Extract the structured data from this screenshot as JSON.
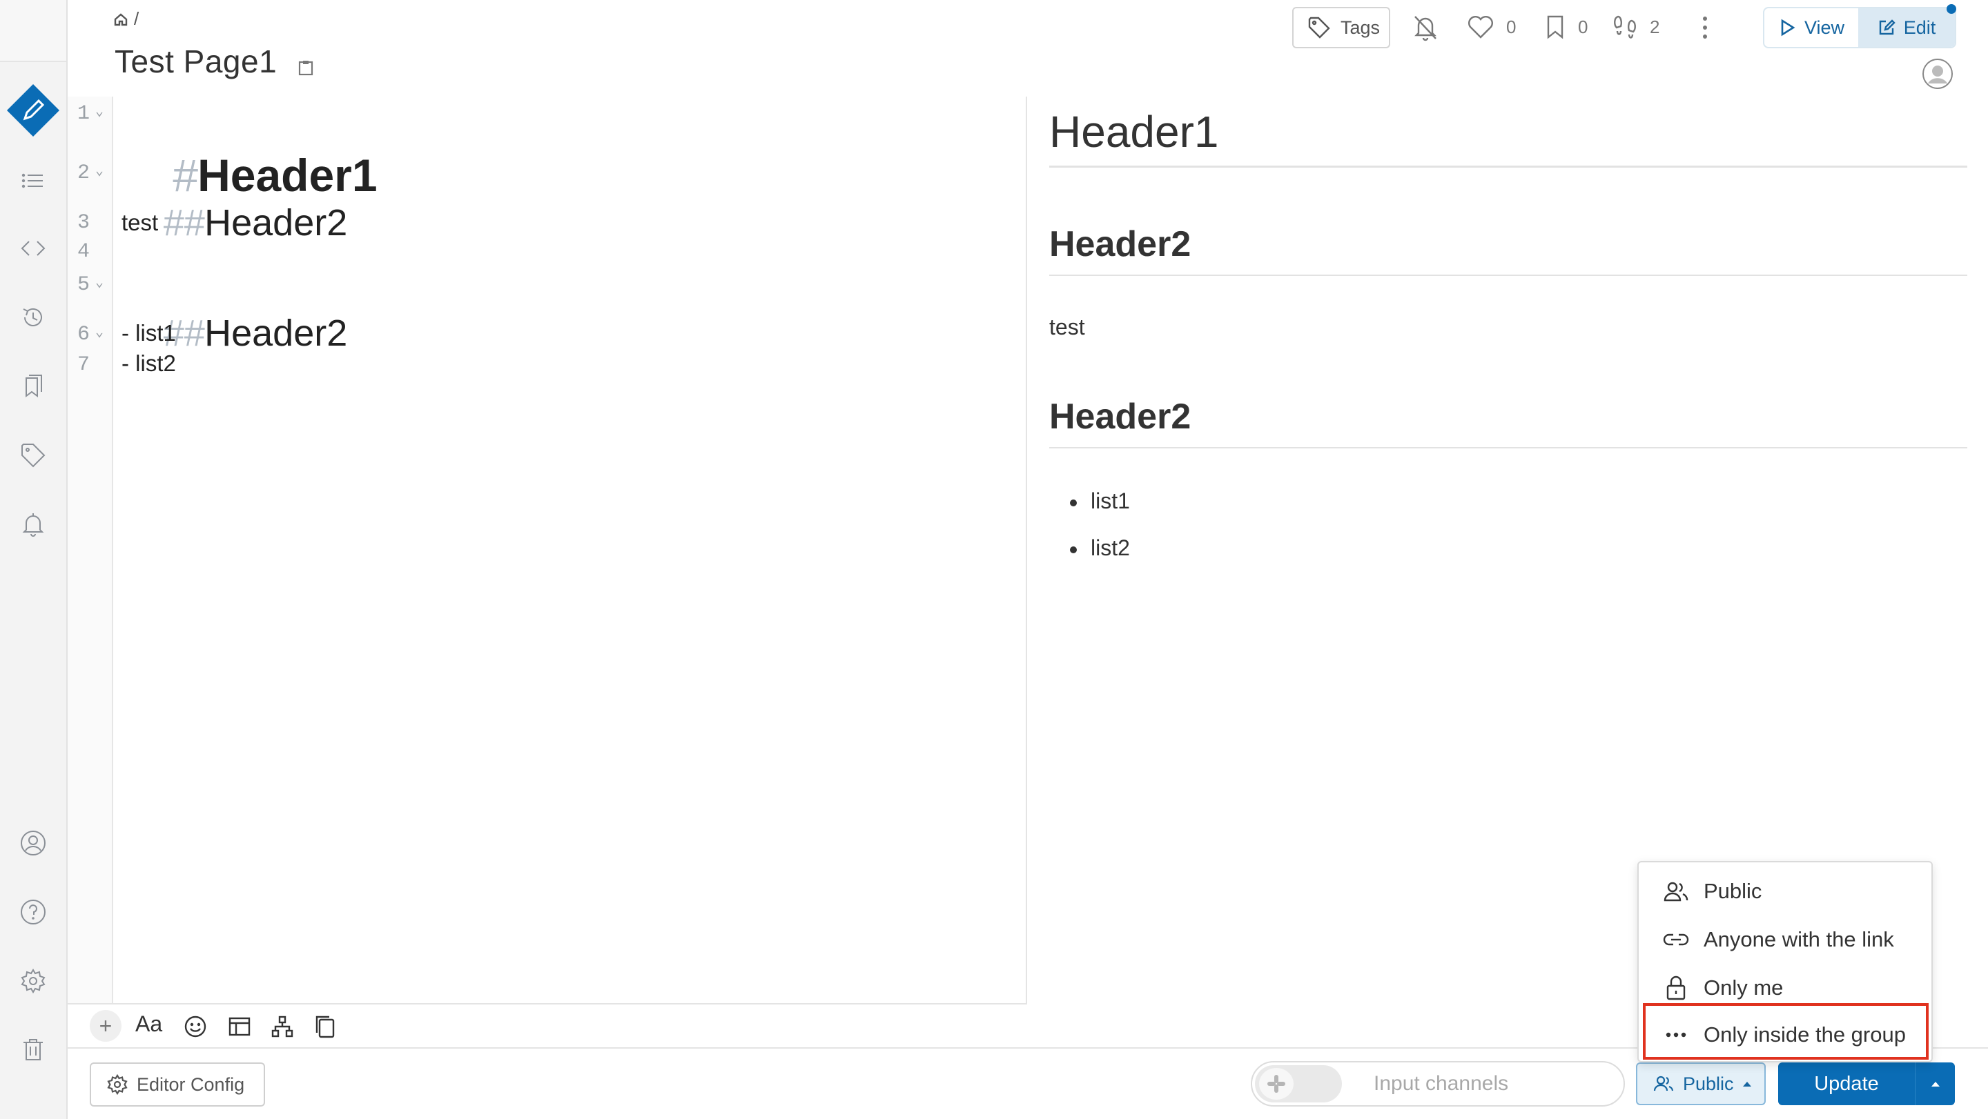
{
  "breadcrumb": {
    "separator": "/"
  },
  "page": {
    "title": "Test Page1"
  },
  "header": {
    "tags_label": "Tags",
    "like_count": "0",
    "bookmark_count": "0",
    "seen_count": "2",
    "view_label": "View",
    "edit_label": "Edit"
  },
  "editor": {
    "line_numbers": [
      "1",
      "2",
      "3",
      "4",
      "5",
      "6",
      "7"
    ],
    "lines": {
      "l1_marker": "#",
      "l1_text": "Header1",
      "l2_marker": "##",
      "l2_text": "Header2",
      "l3_text": "test",
      "l5_marker": "##",
      "l5_text": "Header2",
      "l6_text": "- list1",
      "l7_text": "- list2"
    },
    "toolbar": {
      "plus": "+",
      "text_style": "Aa"
    }
  },
  "preview": {
    "h1": "Header1",
    "h2_first": "Header2",
    "paragraph": "test",
    "h2_second": "Header2",
    "list": [
      "list1",
      "list2"
    ]
  },
  "footer": {
    "editor_config_label": "Editor Config",
    "channels_placeholder": "Input channels",
    "grant_label": "Public",
    "update_label": "Update"
  },
  "grant_menu": {
    "items": [
      "Public",
      "Anyone with the link",
      "Only me",
      "Only inside the group"
    ],
    "highlighted": "Only inside the group"
  },
  "colors": {
    "accent": "#0a6cb5",
    "highlight_border": "#e0321f",
    "sidebar_bg": "#f3f3f3"
  }
}
